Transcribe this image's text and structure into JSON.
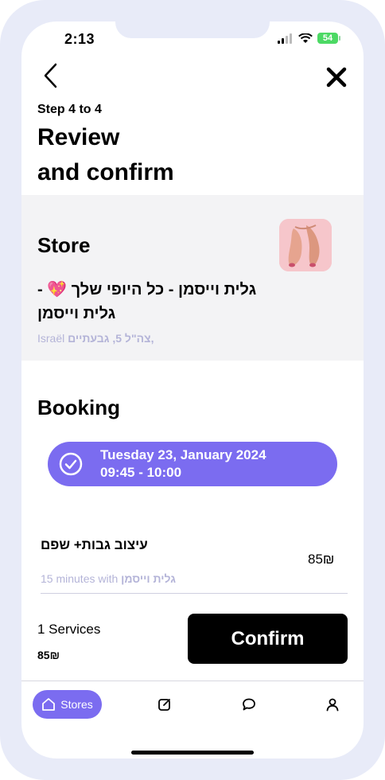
{
  "status_bar": {
    "time": "2:13",
    "battery": "54"
  },
  "header": {
    "step": "Step 4 to 4",
    "title_line1": "Review",
    "title_line2": "and confirm"
  },
  "store": {
    "heading": "Store",
    "name": "גלית וייסמן - כל היופי שלך 💖 - גלית וייסמן",
    "address_street": "צה\"ל 5, גבעתיים,",
    "address_country": "Israël"
  },
  "booking": {
    "heading": "Booking",
    "date": "Tuesday 23, January 2024",
    "time": "09:45 - 10:00"
  },
  "service": {
    "name": "עיצוב גבות+ שפם",
    "price": "85₪",
    "duration": "15 minutes with",
    "staff": "גלית וייסמן"
  },
  "summary": {
    "count": "1 Services",
    "total": "85₪",
    "confirm_label": "Confirm"
  },
  "tabbar": {
    "stores_label": "Stores"
  },
  "colors": {
    "accent": "#7b6cf0",
    "muted": "#b4b4d8",
    "frame": "#e8ebf8"
  }
}
